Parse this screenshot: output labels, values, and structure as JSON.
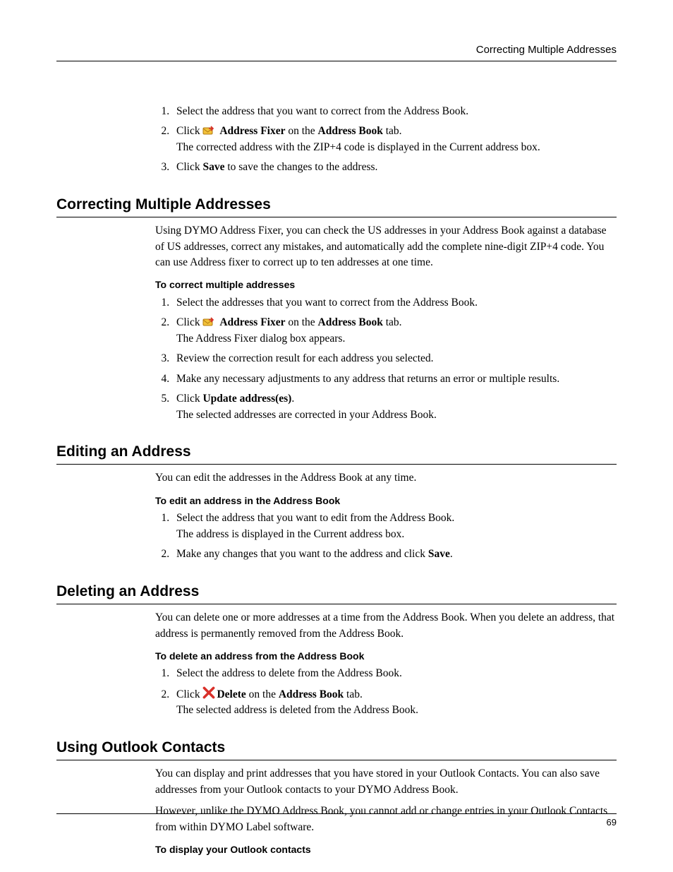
{
  "runningHead": "Correcting Multiple Addresses",
  "pageNumber": "69",
  "topSteps": {
    "s1": "Select the address that you want to correct from the Address Book.",
    "s2_pre": "Click ",
    "s2_b1": "Address Fixer",
    "s2_mid": " on the ",
    "s2_b2": "Address Book",
    "s2_post": " tab.",
    "s2_after": "The corrected address with the ZIP+4 code is displayed in the Current address box.",
    "s3_pre": "Click ",
    "s3_b": "Save",
    "s3_post": " to save the changes to the address."
  },
  "sec1": {
    "title": "Correcting Multiple Addresses",
    "intro": "Using DYMO Address Fixer, you can check the US addresses in your Address Book against a database of US addresses, correct any mistakes, and automatically add the complete nine-digit ZIP+4 code. You can use Address fixer to correct up to ten addresses at one time.",
    "sub": "To correct multiple addresses",
    "s1": "Select the addresses that you want to correct from the Address Book.",
    "s2_pre": "Click ",
    "s2_b1": "Address Fixer",
    "s2_mid": " on the ",
    "s2_b2": "Address Book",
    "s2_post": " tab.",
    "s2_after": "The Address Fixer dialog box appears.",
    "s3": "Review the correction result for each address you selected.",
    "s4": "Make any necessary adjustments to any address that returns an error or multiple results.",
    "s5_pre": "Click ",
    "s5_b": "Update address(es)",
    "s5_post": ".",
    "s5_after": "The selected addresses are corrected in your Address Book."
  },
  "sec2": {
    "title": "Editing an Address",
    "intro": "You can edit the addresses in the Address Book at any time.",
    "sub": "To edit an address in the Address Book",
    "s1": "Select the address that you want to edit from the Address Book.",
    "s1_after": "The address is displayed in the Current address box.",
    "s2_pre": "Make any changes that you want to the address and click ",
    "s2_b": "Save",
    "s2_post": "."
  },
  "sec3": {
    "title": "Deleting an Address",
    "intro": "You can delete one or more addresses at a time from the Address Book. When you delete an address, that address is permanently removed from the Address Book.",
    "sub": "To delete an address from the Address Book",
    "s1": "Select the address to delete from the Address Book.",
    "s2_pre": "Click ",
    "s2_b1": "Delete",
    "s2_mid": " on the ",
    "s2_b2": "Address Book",
    "s2_post": " tab.",
    "s2_after": "The selected address is deleted from the Address Book."
  },
  "sec4": {
    "title": "Using Outlook Contacts",
    "intro1": "You can display and print addresses that you have stored in your Outlook Contacts. You can also save addresses from your Outlook contacts to your DYMO Address Book.",
    "intro2": "However, unlike the DYMO Address Book, you cannot add or change entries in your Outlook Contacts from within DYMO Label software.",
    "sub": "To display your Outlook contacts"
  }
}
